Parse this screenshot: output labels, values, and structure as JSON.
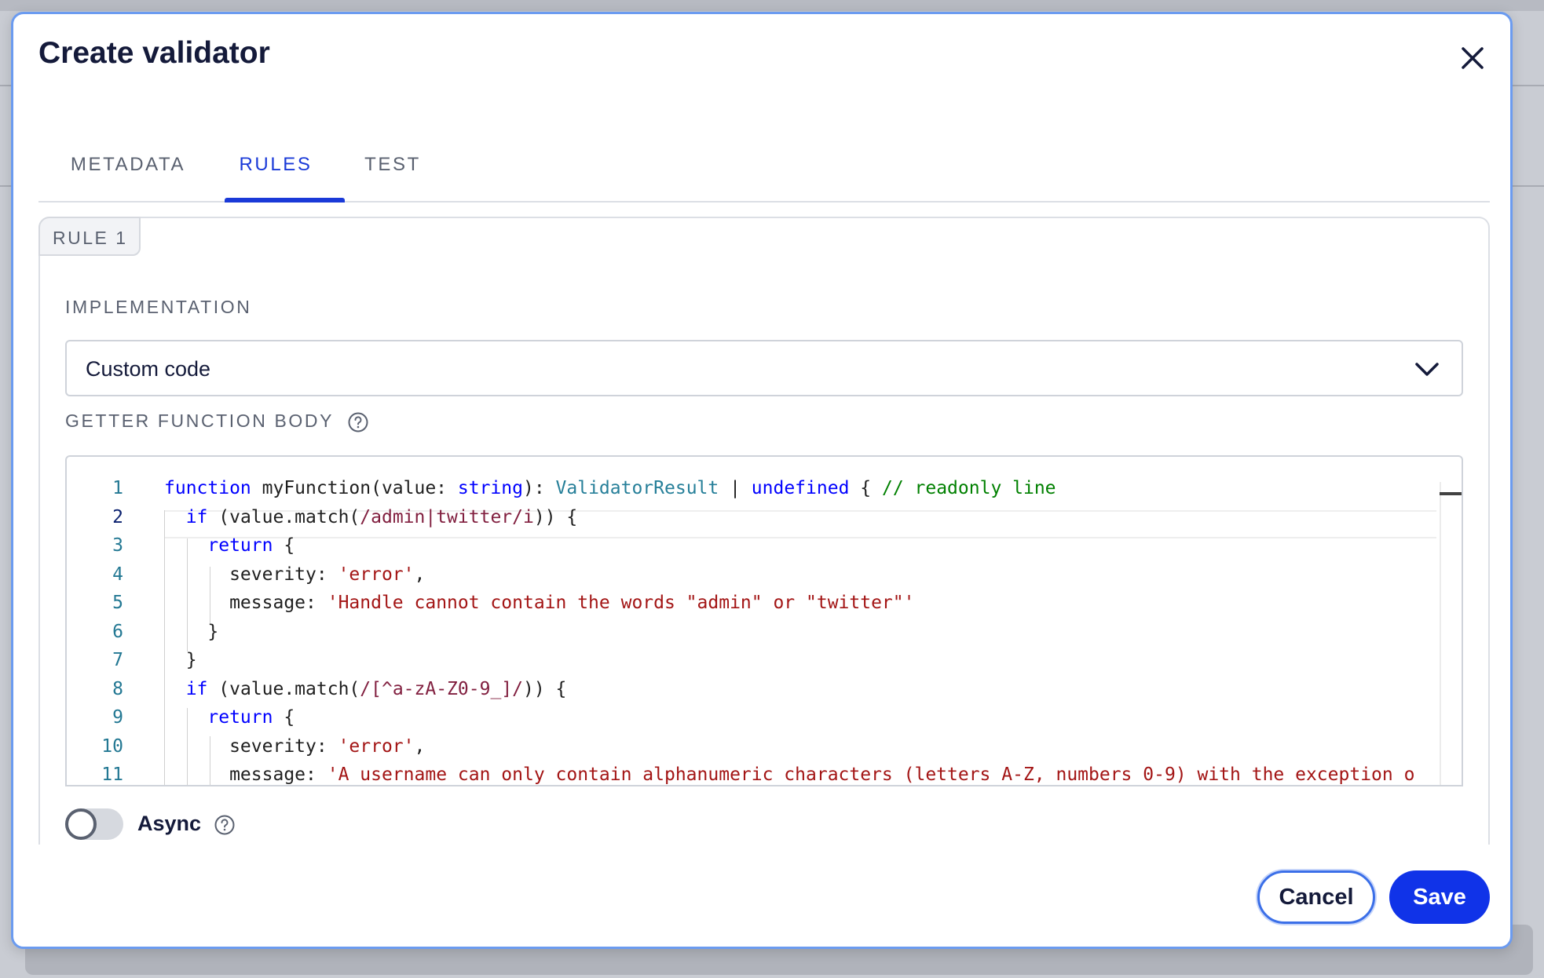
{
  "dialog": {
    "title": "Create validator",
    "close_label": "Close"
  },
  "tabs": [
    {
      "label": "METADATA",
      "active": false
    },
    {
      "label": "RULES",
      "active": true
    },
    {
      "label": "TEST",
      "active": false
    }
  ],
  "rule": {
    "tag": "RULE 1",
    "implementation_label": "IMPLEMENTATION",
    "implementation_value": "Custom code",
    "getter_label": "GETTER FUNCTION BODY",
    "async_label": "Async",
    "async_enabled": false
  },
  "code": {
    "active_line": 2,
    "lines": [
      {
        "n": "1",
        "text": "function myFunction(value: string): ValidatorResult | undefined { // readonly line"
      },
      {
        "n": "2",
        "text": "  if (value.match(/admin|twitter/i)) {"
      },
      {
        "n": "3",
        "text": "    return {"
      },
      {
        "n": "4",
        "text": "      severity: 'error',"
      },
      {
        "n": "5",
        "text": "      message: 'Handle cannot contain the words \"admin\" or \"twitter\"'"
      },
      {
        "n": "6",
        "text": "    }"
      },
      {
        "n": "7",
        "text": "  }"
      },
      {
        "n": "8",
        "text": "  if (value.match(/[^a-zA-Z0-9_]/)) {"
      },
      {
        "n": "9",
        "text": "    return {"
      },
      {
        "n": "10",
        "text": "      severity: 'error',"
      },
      {
        "n": "11",
        "text": "      message: 'A username can only contain alphanumeric characters (letters A-Z, numbers 0-9) with the exception o"
      }
    ]
  },
  "footer": {
    "cancel_label": "Cancel",
    "save_label": "Save"
  },
  "colors": {
    "accent": "#1a3ad8",
    "save_button": "#1033e8",
    "title_text": "#141a3a"
  }
}
